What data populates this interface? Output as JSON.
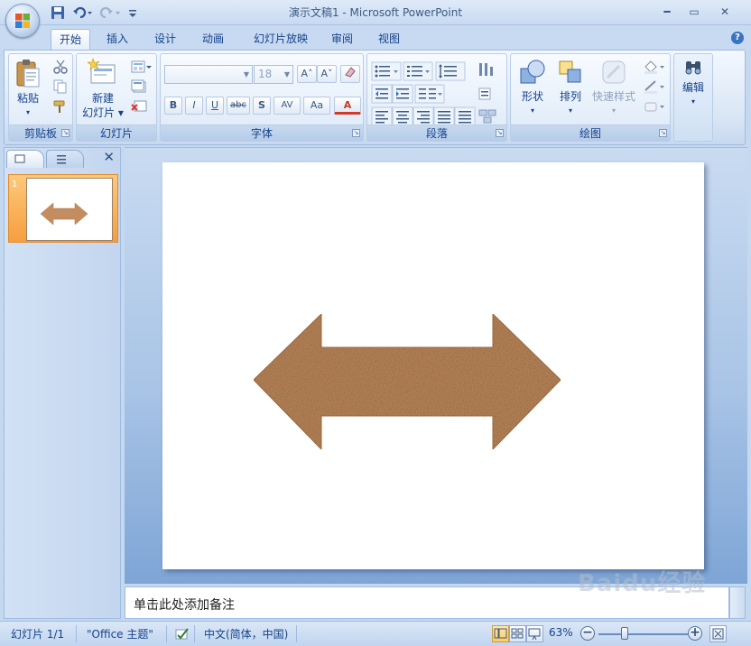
{
  "window": {
    "title": "演示文稿1 - Microsoft PowerPoint",
    "minimize": "━",
    "maximize": "▭",
    "close": "✕"
  },
  "tabs": [
    {
      "label": "开始",
      "active": true
    },
    {
      "label": "插入"
    },
    {
      "label": "设计"
    },
    {
      "label": "动画"
    },
    {
      "label": "幻灯片放映"
    },
    {
      "label": "审阅"
    },
    {
      "label": "视图"
    }
  ],
  "help": "?",
  "ribbon": {
    "clipboard": {
      "label": "剪贴板",
      "paste": "粘贴",
      "paste_arrow": "▾"
    },
    "slides": {
      "label": "幻灯片",
      "new_slide_1": "新建",
      "new_slide_2": "幻灯片 ▾"
    },
    "font": {
      "label": "字体",
      "font_name": "",
      "font_size": "18",
      "buttons": [
        "B",
        "I",
        "U",
        "abc",
        "S",
        "AV",
        "Aa",
        "A"
      ],
      "grow": "A˄",
      "shrink": "A˅"
    },
    "paragraph": {
      "label": "段落"
    },
    "drawing": {
      "label": "绘图",
      "shape": "形状",
      "arrange": "排列",
      "quick_styles": "快速样式"
    },
    "editing": {
      "label": "编辑"
    }
  },
  "left_pane": {
    "close": "✕",
    "slide_number": "1"
  },
  "slide": {
    "shape": "left-right-arrow",
    "fill_color": "#c48d5f"
  },
  "notes": {
    "placeholder": "单击此处添加备注"
  },
  "status": {
    "slide_info": "幻灯片 1/1",
    "theme": "\"Office 主题\"",
    "language": "中文(简体，中国)",
    "zoom": "63%",
    "zoom_level": 0.63
  },
  "watermark": "Baidu经验"
}
